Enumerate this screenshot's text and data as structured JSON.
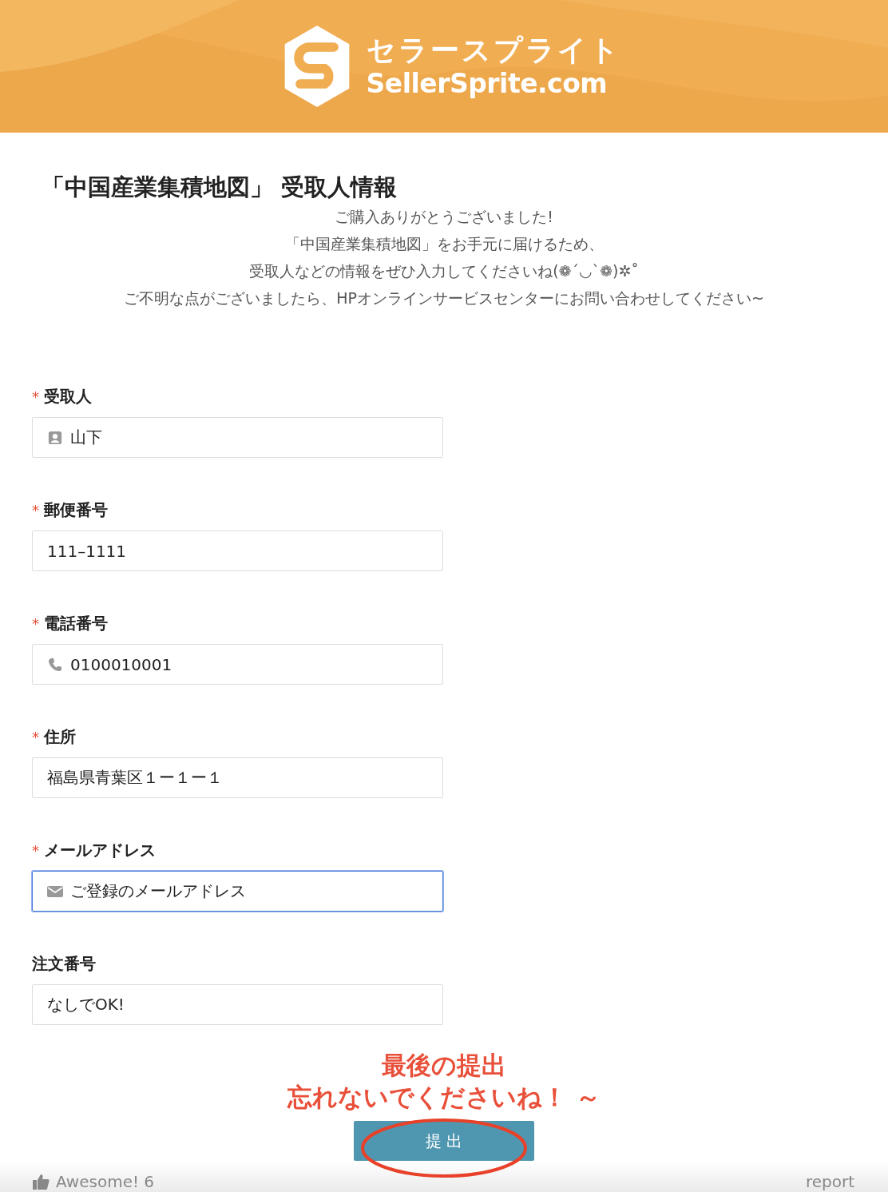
{
  "header": {
    "logo_text_ja": "セラースプライト",
    "logo_text_en": "SellerSprite.com"
  },
  "form": {
    "title": "「中国産業集積地図」 受取人情報",
    "intro": [
      "ご購入ありがとうございました!",
      "「中国産業集積地図」をお手元に届けるため、",
      "受取人などの情報をぜひ入力してくださいね(❁´◡`❁)✲˚",
      "ご不明な点がございましたら、HPオンラインサービスセンターにお問い合わせしてください~"
    ],
    "fields": [
      {
        "required_mark": "*",
        "label": "受取人",
        "kind": "person",
        "value": "山下",
        "focused": false
      },
      {
        "required_mark": "*",
        "label": "郵便番号",
        "kind": "plain",
        "value": "111–1111",
        "focused": false
      },
      {
        "required_mark": "*",
        "label": "電話番号",
        "kind": "phone",
        "value": "0100010001",
        "focused": false
      },
      {
        "required_mark": "*",
        "label": "住所",
        "kind": "plain",
        "value": "福島県青葉区１ー１ー１",
        "focused": false
      },
      {
        "required_mark": "*",
        "label": "メールアドレス",
        "kind": "mail",
        "value": "ご登録のメールアドレス",
        "focused": true
      },
      {
        "label": "注文番号",
        "kind": "plain",
        "value": "なしでOK!",
        "focused": false
      }
    ],
    "reminder": [
      "最後の提出",
      "忘れないでくださいね！ ～"
    ],
    "submit_button": "提 出"
  },
  "footer": {
    "like_label": "Awesome! 6",
    "report_link": "report"
  }
}
